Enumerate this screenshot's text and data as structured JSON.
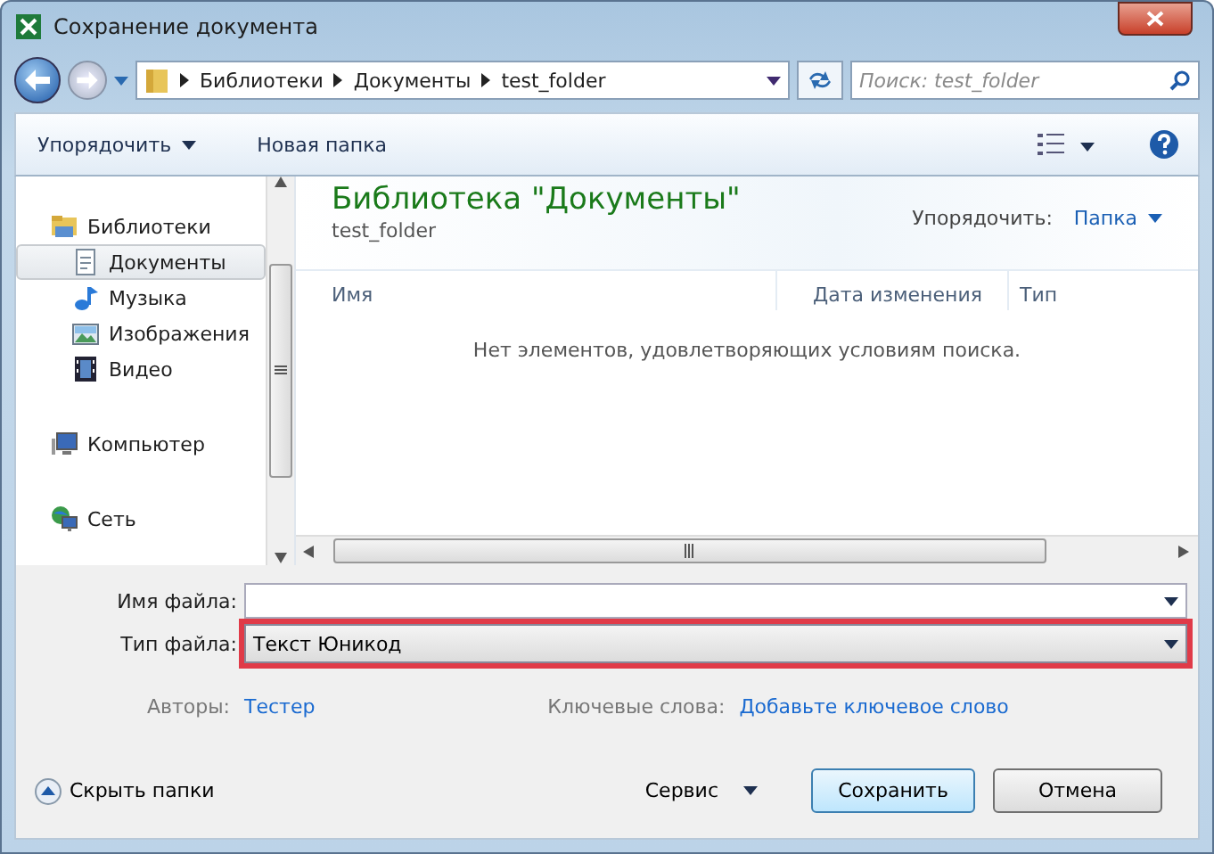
{
  "window": {
    "title": "Сохранение документа"
  },
  "address": {
    "crumbs": [
      "Библиотеки",
      "Документы",
      "test_folder"
    ]
  },
  "search": {
    "placeholder": "Поиск: test_folder"
  },
  "toolbar": {
    "buttons": [
      "Упорядочить",
      "Новая папка"
    ]
  },
  "sidebar": {
    "items": [
      {
        "label": "Библиотеки",
        "selected": false,
        "children": [
          {
            "label": "Документы",
            "selected": true
          },
          {
            "label": "Музыка",
            "selected": false
          },
          {
            "label": "Изображения",
            "selected": false
          },
          {
            "label": "Видео",
            "selected": false
          }
        ]
      },
      {
        "label": "Компьютер",
        "selected": false
      },
      {
        "label": "Сеть",
        "selected": false
      }
    ]
  },
  "content": {
    "title": "Библиотека \"Документы\"",
    "subtitle": "test_folder",
    "arrange_label": "Упорядочить:",
    "arrange_value": "Папка",
    "columns": [
      "Имя",
      "Дата изменения",
      "Тип"
    ],
    "empty_message": "Нет элементов, удовлетворяющих условиям поиска."
  },
  "form": {
    "filename": {
      "label": "Имя файла:"
    },
    "filetype": {
      "label": "Тип файла:",
      "value": "Текст Юникод",
      "highlighted": true
    },
    "authors": {
      "label": "Авторы:",
      "value": "Тестер"
    },
    "keywords": {
      "label": "Ключевые слова:",
      "value": "Добавьте ключевое слово"
    }
  },
  "footer": {
    "hide_folders": "Скрыть папки",
    "tools": "Сервис",
    "save": "Сохранить",
    "cancel": "Отмена"
  }
}
